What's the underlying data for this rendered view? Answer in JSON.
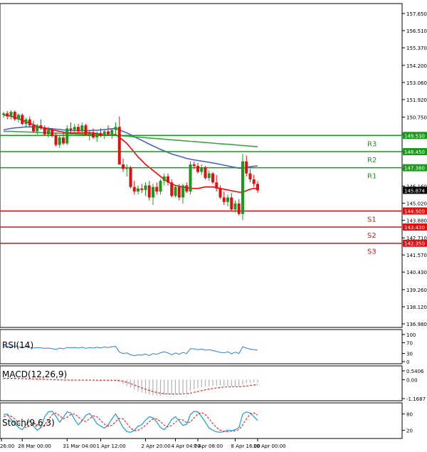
{
  "chart_data": {
    "type": "candlestick",
    "main": {
      "y_ticks": [
        "157.650",
        "156.510",
        "155.370",
        "154.200",
        "153.060",
        "151.920",
        "150.750",
        "149.610",
        "148.470",
        "147.300",
        "146.160",
        "145.020",
        "143.880",
        "142.710",
        "141.570",
        "140.430",
        "139.260",
        "138.120",
        "136.980"
      ],
      "ylim": [
        136.98,
        157.65
      ],
      "current_price": "145.874",
      "candles": [
        [
          150.9,
          151.1,
          150.7,
          151.0
        ],
        [
          151.0,
          151.15,
          150.6,
          150.8
        ],
        [
          150.8,
          151.2,
          150.6,
          151.1
        ],
        [
          151.1,
          151.2,
          150.5,
          150.6
        ],
        [
          150.6,
          151.0,
          150.4,
          150.9
        ],
        [
          150.9,
          151.0,
          150.2,
          150.3
        ],
        [
          150.3,
          150.7,
          150.1,
          150.6
        ],
        [
          150.6,
          150.8,
          150.1,
          150.2
        ],
        [
          150.2,
          150.5,
          149.7,
          149.8
        ],
        [
          149.8,
          150.3,
          149.6,
          150.2
        ],
        [
          150.2,
          150.6,
          149.9,
          150.0
        ],
        [
          150.0,
          150.2,
          149.5,
          149.6
        ],
        [
          149.6,
          150.1,
          149.4,
          149.9
        ],
        [
          149.9,
          150.0,
          149.4,
          149.5
        ],
        [
          149.5,
          149.7,
          148.8,
          148.9
        ],
        [
          148.9,
          149.5,
          148.7,
          149.4
        ],
        [
          149.4,
          149.8,
          148.9,
          149.0
        ],
        [
          149.0,
          150.2,
          148.9,
          150.0
        ],
        [
          150.0,
          150.4,
          149.6,
          149.9
        ],
        [
          149.9,
          150.3,
          149.6,
          150.1
        ],
        [
          150.1,
          150.3,
          149.7,
          149.8
        ],
        [
          149.8,
          150.4,
          149.6,
          150.2
        ],
        [
          150.2,
          150.3,
          149.5,
          149.6
        ],
        [
          149.6,
          149.9,
          149.2,
          149.7
        ],
        [
          149.7,
          150.0,
          149.3,
          149.4
        ],
        [
          149.4,
          149.8,
          149.1,
          149.7
        ],
        [
          149.7,
          150.0,
          149.4,
          149.5
        ],
        [
          149.5,
          149.9,
          149.3,
          149.8
        ],
        [
          149.8,
          150.2,
          149.5,
          149.6
        ],
        [
          149.6,
          150.0,
          149.3,
          149.9
        ],
        [
          149.9,
          150.4,
          149.6,
          150.1
        ],
        [
          150.1,
          150.8,
          148.9,
          147.6
        ],
        [
          147.6,
          148.0,
          147.1,
          147.3
        ],
        [
          147.3,
          147.6,
          146.8,
          147.4
        ],
        [
          147.4,
          147.5,
          146.0,
          146.1
        ],
        [
          146.1,
          146.5,
          145.6,
          145.8
        ],
        [
          145.8,
          146.2,
          145.6,
          146.0
        ],
        [
          146.0,
          146.3,
          145.7,
          145.9
        ],
        [
          145.9,
          146.4,
          145.5,
          146.2
        ],
        [
          146.2,
          146.5,
          145.2,
          145.4
        ],
        [
          145.4,
          146.3,
          144.9,
          146.1
        ],
        [
          146.1,
          146.4,
          145.6,
          145.8
        ],
        [
          145.8,
          146.6,
          145.6,
          146.5
        ],
        [
          146.5,
          147.0,
          146.2,
          146.8
        ],
        [
          146.8,
          147.0,
          146.2,
          146.4
        ],
        [
          146.4,
          146.6,
          145.4,
          145.5
        ],
        [
          145.5,
          146.2,
          145.4,
          146.1
        ],
        [
          146.1,
          146.3,
          145.2,
          145.4
        ],
        [
          145.4,
          146.3,
          145.0,
          146.2
        ],
        [
          146.2,
          146.4,
          145.7,
          145.8
        ],
        [
          145.8,
          147.8,
          145.6,
          147.6
        ],
        [
          147.6,
          147.8,
          147.3,
          147.5
        ],
        [
          147.5,
          147.7,
          147.0,
          147.1
        ],
        [
          147.1,
          147.6,
          146.9,
          147.4
        ],
        [
          147.4,
          147.5,
          146.6,
          146.7
        ],
        [
          146.7,
          147.2,
          146.5,
          147.0
        ],
        [
          147.0,
          147.1,
          146.3,
          146.4
        ],
        [
          146.4,
          146.9,
          145.8,
          146.0
        ],
        [
          146.0,
          146.2,
          145.3,
          145.4
        ],
        [
          145.4,
          145.8,
          144.9,
          145.1
        ],
        [
          145.1,
          145.6,
          144.8,
          145.4
        ],
        [
          145.4,
          145.7,
          144.5,
          144.6
        ],
        [
          144.6,
          145.2,
          144.4,
          145.0
        ],
        [
          145.0,
          145.3,
          144.2,
          144.3
        ],
        [
          144.3,
          148.3,
          143.9,
          147.8
        ],
        [
          147.8,
          148.2,
          146.8,
          147.0
        ],
        [
          147.0,
          147.3,
          146.4,
          146.6
        ],
        [
          146.6,
          146.9,
          146.1,
          146.3
        ],
        [
          146.3,
          146.5,
          145.7,
          145.87
        ]
      ],
      "ma_red": [
        150.9,
        150.85,
        150.8,
        150.75,
        150.65,
        150.55,
        150.45,
        150.35,
        150.25,
        150.15,
        150.05,
        150.0,
        149.95,
        149.9,
        149.85,
        149.8,
        149.75,
        149.7,
        149.7,
        149.7,
        149.7,
        149.7,
        149.72,
        149.72,
        149.7,
        149.65,
        149.6,
        149.55,
        149.55,
        149.55,
        149.6,
        149.4,
        149.2,
        149.0,
        148.7,
        148.4,
        148.1,
        147.85,
        147.6,
        147.4,
        147.2,
        147.0,
        146.8,
        146.6,
        146.45,
        146.3,
        146.2,
        146.15,
        146.1,
        146.05,
        146.0,
        146.0,
        146.0,
        146.05,
        146.1,
        146.1,
        146.1,
        146.05,
        146.0,
        145.95,
        145.9,
        145.85,
        145.8,
        145.75,
        145.75,
        145.85,
        145.95,
        146.0,
        146.0
      ],
      "ma_blue": [
        149.9,
        149.95,
        150.0,
        150.03,
        150.05,
        150.08,
        150.1,
        150.1,
        150.1,
        150.08,
        150.05,
        150.03,
        150.0,
        149.98,
        149.95,
        149.93,
        149.9,
        149.88,
        149.85,
        149.85,
        149.85,
        149.85,
        149.85,
        149.86,
        149.87,
        149.88,
        149.9,
        149.92,
        149.95,
        149.98,
        150.0,
        149.9,
        149.8,
        149.7,
        149.58,
        149.45,
        149.32,
        149.2,
        149.08,
        148.95,
        148.83,
        148.72,
        148.6,
        148.5,
        148.4,
        148.3,
        148.22,
        148.15,
        148.08,
        148.0,
        147.95,
        147.9,
        147.86,
        147.82,
        147.78,
        147.74,
        147.7,
        147.65,
        147.6,
        147.55,
        147.5,
        147.45,
        147.4,
        147.35,
        147.35,
        147.4,
        147.45,
        147.48,
        147.5
      ],
      "ma_green": [
        149.8,
        149.8,
        149.8,
        149.79,
        149.78,
        149.77,
        149.76,
        149.75,
        149.74,
        149.73,
        149.72,
        149.71,
        149.7,
        149.69,
        149.68,
        149.67,
        149.66,
        149.65,
        149.64,
        149.63,
        149.62,
        149.61,
        149.6,
        149.59,
        149.58,
        149.57,
        149.56,
        149.55,
        149.54,
        149.54,
        149.54,
        149.52,
        149.5,
        149.48,
        149.46,
        149.44,
        149.42,
        149.4,
        149.38,
        149.36,
        149.34,
        149.32,
        149.3,
        149.28,
        149.26,
        149.24,
        149.22,
        149.2,
        149.18,
        149.16,
        149.14,
        149.12,
        149.1,
        149.08,
        149.06,
        149.04,
        149.02,
        149.0,
        148.98,
        148.96,
        148.94,
        148.92,
        148.9,
        148.88,
        148.86,
        148.84,
        148.82,
        148.8,
        148.78
      ],
      "levels": [
        {
          "name": "R3",
          "value": 149.53,
          "label": "149.530",
          "color": "#1a9a1a"
        },
        {
          "name": "R2",
          "value": 148.45,
          "label": "148.450",
          "color": "#1a9a1a"
        },
        {
          "name": "R1",
          "value": 147.38,
          "label": "147.380",
          "color": "#1a9a1a"
        },
        {
          "name": "S1",
          "value": 144.5,
          "label": "144.500",
          "color": "#e01010"
        },
        {
          "name": "S2",
          "value": 143.43,
          "label": "143.430",
          "color": "#e01010"
        },
        {
          "name": "S3",
          "value": 142.35,
          "label": "142.350",
          "color": "#e01010"
        }
      ]
    },
    "rsi": {
      "title": "RSI(14)",
      "y_ticks": [
        "100",
        "70",
        "30",
        "0"
      ],
      "ylim": [
        0,
        100
      ],
      "values": [
        55,
        56,
        54,
        57,
        55,
        53,
        54,
        52,
        50,
        52,
        51,
        49,
        50,
        48,
        45,
        50,
        47,
        52,
        51,
        52,
        50,
        53,
        49,
        52,
        50,
        53,
        51,
        54,
        52,
        55,
        56,
        35,
        30,
        32,
        25,
        22,
        25,
        24,
        28,
        22,
        30,
        27,
        33,
        36,
        32,
        25,
        32,
        27,
        34,
        30,
        48,
        47,
        44,
        46,
        42,
        44,
        41,
        38,
        34,
        32,
        36,
        29,
        35,
        30,
        55,
        50,
        46,
        44,
        42
      ]
    },
    "macd": {
      "title": "MACD(12,26,9)",
      "y_ticks": [
        "0.5406",
        "0.00",
        "-1.1687"
      ],
      "ylim": [
        -1.1687,
        0.5406
      ],
      "histogram": [
        0.1,
        0.1,
        0.09,
        0.09,
        0.08,
        0.07,
        0.06,
        0.05,
        0.04,
        0.03,
        0.02,
        0.01,
        0.0,
        -0.01,
        -0.02,
        -0.03,
        -0.04,
        -0.04,
        -0.04,
        -0.03,
        -0.03,
        -0.03,
        -0.03,
        -0.03,
        -0.04,
        -0.04,
        -0.04,
        -0.04,
        -0.04,
        -0.03,
        -0.03,
        -0.15,
        -0.28,
        -0.38,
        -0.5,
        -0.62,
        -0.72,
        -0.8,
        -0.86,
        -0.92,
        -0.96,
        -0.98,
        -0.98,
        -0.96,
        -0.94,
        -0.92,
        -0.9,
        -0.88,
        -0.84,
        -0.8,
        -0.7,
        -0.6,
        -0.52,
        -0.46,
        -0.42,
        -0.4,
        -0.38,
        -0.38,
        -0.38,
        -0.4,
        -0.4,
        -0.42,
        -0.42,
        -0.44,
        -0.3,
        -0.22,
        -0.18,
        -0.16,
        -0.16
      ],
      "signal": [
        0.08,
        0.08,
        0.08,
        0.08,
        0.07,
        0.07,
        0.06,
        0.06,
        0.05,
        0.04,
        0.03,
        0.02,
        0.01,
        0.0,
        -0.01,
        -0.02,
        -0.02,
        -0.03,
        -0.03,
        -0.03,
        -0.03,
        -0.03,
        -0.03,
        -0.03,
        -0.03,
        -0.04,
        -0.04,
        -0.04,
        -0.04,
        -0.04,
        -0.04,
        -0.06,
        -0.1,
        -0.16,
        -0.24,
        -0.33,
        -0.42,
        -0.51,
        -0.59,
        -0.66,
        -0.73,
        -0.79,
        -0.83,
        -0.86,
        -0.88,
        -0.89,
        -0.89,
        -0.89,
        -0.88,
        -0.86,
        -0.83,
        -0.78,
        -0.73,
        -0.68,
        -0.63,
        -0.58,
        -0.54,
        -0.51,
        -0.48,
        -0.46,
        -0.45,
        -0.44,
        -0.44,
        -0.44,
        -0.42,
        -0.39,
        -0.36,
        -0.33,
        -0.3
      ]
    },
    "stoch": {
      "title": "Stoch(9,6,3)",
      "y_ticks": [
        "80",
        "20"
      ],
      "ylim": [
        0,
        100
      ],
      "k": [
        78,
        80,
        60,
        45,
        30,
        22,
        40,
        55,
        35,
        20,
        30,
        70,
        88,
        90,
        72,
        50,
        68,
        88,
        84,
        60,
        40,
        55,
        75,
        82,
        66,
        44,
        35,
        28,
        40,
        62,
        80,
        55,
        30,
        15,
        12,
        20,
        35,
        40,
        58,
        70,
        66,
        50,
        30,
        22,
        38,
        60,
        70,
        55,
        38,
        42,
        78,
        90,
        88,
        70,
        50,
        28,
        20,
        14,
        12,
        15,
        20,
        18,
        22,
        30,
        80,
        88,
        84,
        70,
        56
      ],
      "d": [
        70,
        75,
        72,
        62,
        48,
        35,
        30,
        38,
        45,
        42,
        30,
        40,
        60,
        78,
        84,
        74,
        62,
        68,
        78,
        80,
        70,
        56,
        52,
        62,
        74,
        70,
        56,
        42,
        35,
        38,
        52,
        64,
        62,
        45,
        28,
        18,
        20,
        28,
        38,
        52,
        62,
        62,
        52,
        38,
        32,
        38,
        50,
        60,
        58,
        48,
        50,
        66,
        80,
        86,
        78,
        62,
        44,
        30,
        20,
        15,
        15,
        17,
        18,
        22,
        40,
        62,
        80,
        84,
        76
      ]
    },
    "x_ticks": [
      "26:00",
      "28 Mar 00:00",
      "31 Mar 04:00",
      "1 Apr 12:00",
      "2 Apr 20:00",
      "4 Apr 04:00",
      "7 Apr 08:00",
      "8 Apr 16:00",
      "10 Apr 00:00"
    ],
    "colors": {
      "bull": "#1a9a1a",
      "bear": "#e01010",
      "ma_red": "#ff0000",
      "ma_blue": "#4a63c8",
      "ma_green": "#3fa34a",
      "rsi": "#2a82d8",
      "macd_hist": "#b0b0b0",
      "macd_signal": "#ff0000",
      "stoch_k": "#1a9fd0",
      "stoch_d": "#ff0000",
      "axis": "#000000"
    }
  }
}
